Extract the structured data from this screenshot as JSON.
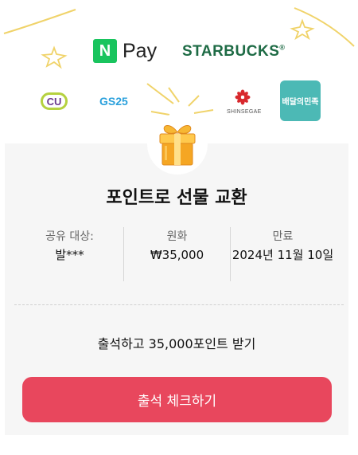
{
  "partners": {
    "npay_n": "N",
    "npay_pay": "Pay",
    "starbucks": "STARBUCKS",
    "starbucks_reg": "®",
    "cu": "CU",
    "gs25": "GS25",
    "shinsegae": "SHINSEGAE",
    "baemin": "배달의민족"
  },
  "title": "포인트로 선물 교환",
  "details": {
    "share_label": "공유 대상:",
    "share_value": "발***",
    "amount_label": "원화",
    "amount_value": "₩35,000",
    "expiry_label": "만료",
    "expiry_value": "2024년 11월 10일"
  },
  "earn_text": "출석하고 35,000포인트 받기",
  "cta_label": "출석 체크하기",
  "colors": {
    "cta": "#e8475d",
    "npay_green": "#19c45e",
    "starbucks_green": "#1e6b45",
    "baemin_teal": "#4cb9b5",
    "gift_orange": "#f5a623"
  },
  "icons": [
    "gift-box-icon",
    "sparkle-star-icon",
    "shinsegae-flower-icon"
  ]
}
